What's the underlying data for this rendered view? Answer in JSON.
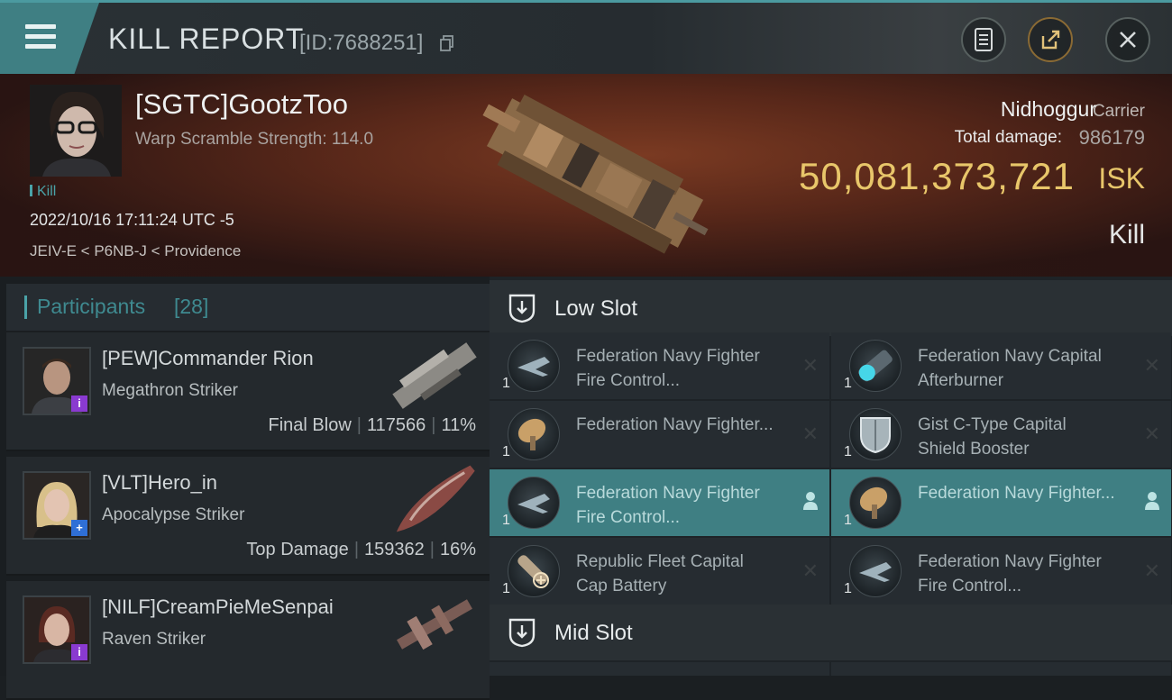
{
  "header": {
    "title": "KILL REPORT",
    "report_id": "[ID:7688251]"
  },
  "victim": {
    "name": "[SGTC]GootzToo",
    "warp_scramble": "Warp Scramble Strength: 114.0",
    "tag": "Kill",
    "timestamp": "2022/10/16 17:11:24 UTC -5",
    "location": "JEIV-E < P6NB-J < Providence",
    "ship_name": "Nidhoggur",
    "ship_class": "Carrier",
    "total_damage_label": "Total damage:",
    "total_damage": "986179",
    "isk_value": "50,081,373,721",
    "isk_unit": "ISK",
    "result": "Kill"
  },
  "participants": {
    "label": "Participants",
    "count": "[28]",
    "items": [
      {
        "name": "[PEW]Commander Rion",
        "ship": "Megathron Striker",
        "role": "Final Blow",
        "damage": "117566",
        "percent": "11%",
        "badge": "i",
        "badge_color": "#8a3ad0"
      },
      {
        "name": "[VLT]Hero_in",
        "ship": "Apocalypse Striker",
        "role": "Top Damage",
        "damage": "159362",
        "percent": "16%",
        "badge": "+",
        "badge_color": "#2f6fd6"
      },
      {
        "name": "[NILF]CreamPieMeSenpai",
        "ship": "Raven Striker",
        "role": "",
        "damage": "",
        "percent": "",
        "badge": "i",
        "badge_color": "#8a3ad0"
      }
    ]
  },
  "fitting": {
    "low_slot_label": "Low Slot",
    "mid_slot_label": "Mid Slot",
    "low_slot": [
      {
        "name": "Federation Navy Fighter Fire Control...",
        "qty": "1",
        "icon": "fighter-fire-control-icon",
        "highlight": false
      },
      {
        "name": "Federation Navy Capital Afterburner",
        "qty": "1",
        "icon": "afterburner-icon",
        "highlight": false
      },
      {
        "name": "Federation Navy Fighter...",
        "qty": "1",
        "icon": "fighter-support-icon",
        "highlight": false
      },
      {
        "name": "Gist C-Type Capital Shield Booster",
        "qty": "1",
        "icon": "shield-booster-icon",
        "highlight": false
      },
      {
        "name": "Federation Navy Fighter Fire Control...",
        "qty": "1",
        "icon": "fighter-fire-control-icon",
        "highlight": true
      },
      {
        "name": "Federation Navy Fighter...",
        "qty": "1",
        "icon": "fighter-support-icon",
        "highlight": true
      },
      {
        "name": "Republic Fleet Capital Cap Battery",
        "qty": "1",
        "icon": "cap-battery-icon",
        "highlight": false
      },
      {
        "name": "Federation Navy Fighter Fire Control...",
        "qty": "1",
        "icon": "fighter-fire-control-icon",
        "highlight": false
      }
    ]
  }
}
